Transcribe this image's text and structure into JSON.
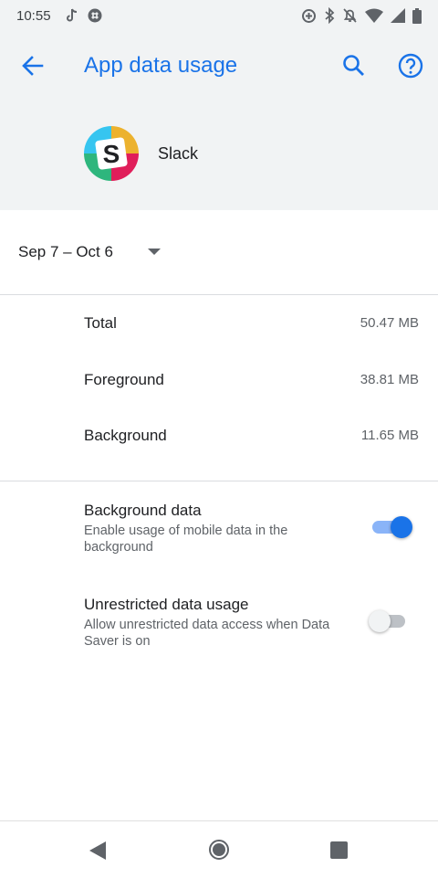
{
  "status_bar": {
    "time": "10:55",
    "left_icons": [
      "tiktok-icon",
      "slack-notification-icon"
    ],
    "right_icons": [
      "data-saver-icon",
      "bluetooth-icon",
      "mute-icon",
      "wifi-icon",
      "signal-icon",
      "battery-icon"
    ]
  },
  "header": {
    "title": "App data usage",
    "back_icon": "arrow-back-icon",
    "search_icon": "search-icon",
    "help_icon": "help-icon"
  },
  "app": {
    "name": "Slack",
    "logo": "slack-logo"
  },
  "date_range": {
    "label": "Sep 7 – Oct 6"
  },
  "usage": [
    {
      "label": "Total",
      "value": "50.47 MB"
    },
    {
      "label": "Foreground",
      "value": "38.81 MB"
    },
    {
      "label": "Background",
      "value": "11.65 MB"
    }
  ],
  "settings": [
    {
      "title": "Background data",
      "summary": "Enable usage of mobile data in the background",
      "enabled": true
    },
    {
      "title": "Unrestricted data usage",
      "summary": "Allow unrestricted data access when Data Saver is on",
      "enabled": false
    }
  ],
  "colors": {
    "accent": "#1a73e8",
    "header_bg": "#f1f3f4",
    "divider": "#dadce0"
  },
  "nav_bar": {
    "icons": [
      "nav-back-icon",
      "nav-home-icon",
      "nav-recents-icon"
    ]
  }
}
